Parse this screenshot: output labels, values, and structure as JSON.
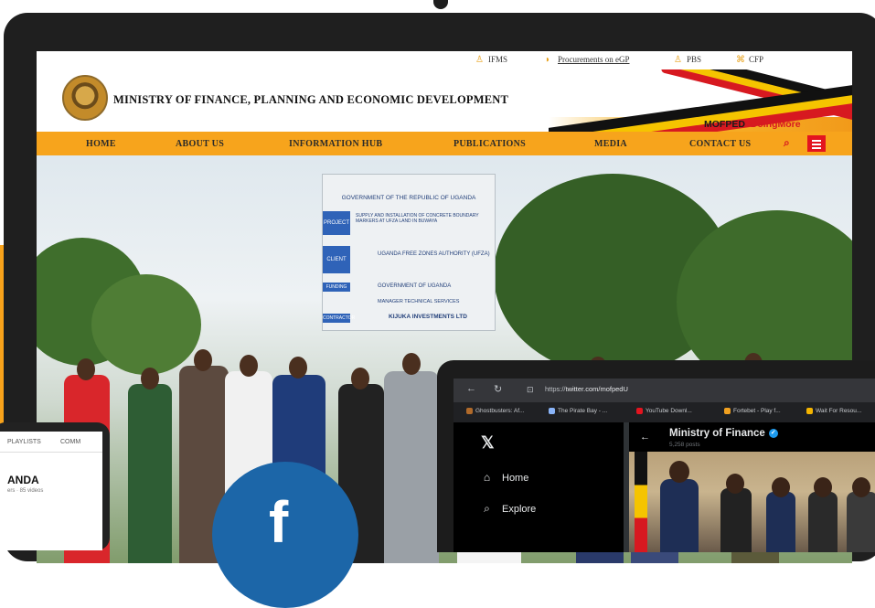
{
  "website": {
    "utility_links": [
      {
        "label": "IFMS",
        "icon": "users-icon"
      },
      {
        "label": "Procurements on eGP",
        "icon": "handshake-icon"
      },
      {
        "label": "PBS",
        "icon": "users-icon"
      },
      {
        "label": "CFP",
        "icon": "grid-icon"
      }
    ],
    "ministry_title": "MINISTRY OF FINANCE, PLANNING AND ECONOMIC DEVELOPMENT",
    "hashtag_prefix": "MOFPED",
    "hashtag": "#DoingMore",
    "nav": [
      "HOME",
      "ABOUT US",
      "INFORMATION HUB",
      "PUBLICATIONS",
      "MEDIA",
      "CONTACT US"
    ],
    "sign": {
      "header": "GOVERNMENT OF THE REPUBLIC OF UGANDA",
      "project_tag": "PROJECT",
      "project_text": "SUPPLY AND INSTALLATION OF CONCRETE BOUNDARY MARKERS AT UFZA LAND IN BUWAYA",
      "client_tag": "CLIENT",
      "client_text": "UGANDA FREE ZONES AUTHORITY (UFZA)",
      "funding_tag": "FUNDING",
      "funding_text": "GOVERNMENT OF UGANDA",
      "manager_text": "MANAGER TECHNICAL SERVICES",
      "contractor_tag": "CONTRACTOR",
      "contractor_text": "KIJUKA INVESTMENTS LTD"
    }
  },
  "tablet": {
    "tabs": [
      "PLAYLISTS",
      "COMM"
    ],
    "title": "ANDA",
    "subtitle": "ers · 85 videos"
  },
  "twitter_browser": {
    "url_prefix": "https://",
    "url_host": "twitter.com/mofpedU",
    "bookmarks": [
      {
        "label": "Ghostbusters: Af...",
        "color": "#b06a2a"
      },
      {
        "label": "The Pirate Bay - ...",
        "color": "#8ab4f8"
      },
      {
        "label": "YouTube Downl...",
        "color": "#e3141f"
      },
      {
        "label": "Fortebet - Play f...",
        "color": "#f0a020"
      },
      {
        "label": "Wait For Resou...",
        "color": "#f4b400"
      }
    ],
    "sidebar": [
      {
        "label": "Home",
        "icon": "home-icon"
      },
      {
        "label": "Explore",
        "icon": "search-icon"
      }
    ],
    "profile_name": "Ministry of Finance",
    "posts_count": "5,258 posts"
  }
}
